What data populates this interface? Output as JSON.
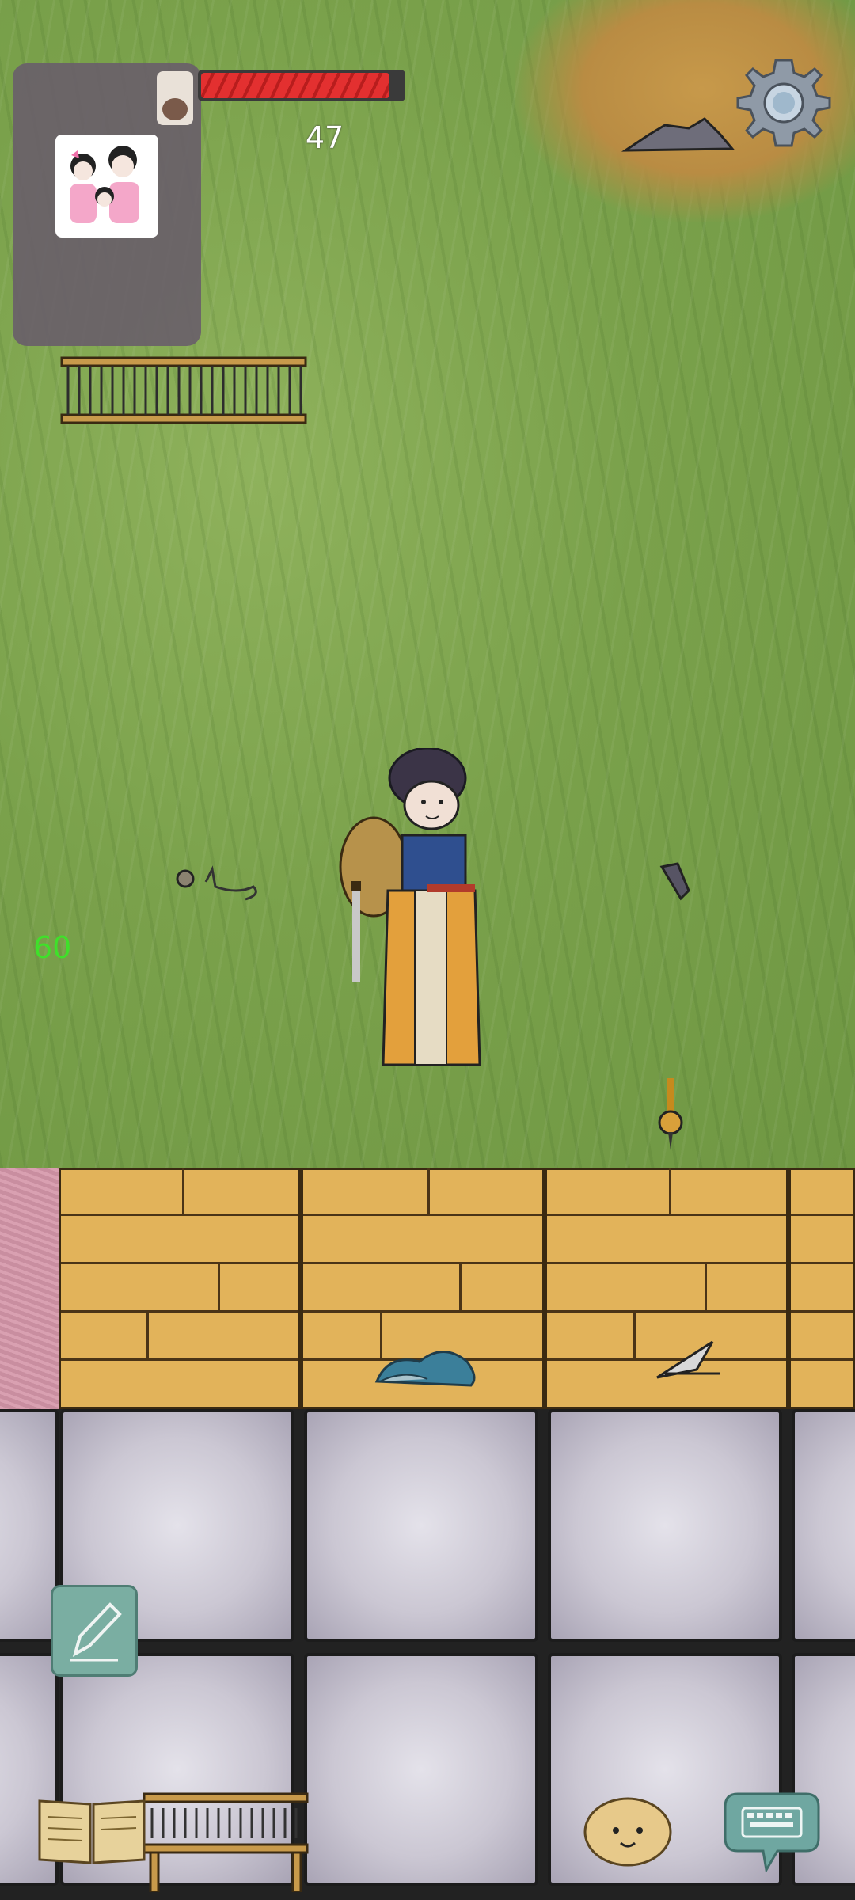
{
  "hud": {
    "food_count": "47",
    "fps": "60",
    "health_fraction": 0.94
  },
  "icons": {
    "settings": "gear-icon",
    "write": "pencil-icon",
    "journal": "book-icon",
    "emote": "face-icon",
    "chat": "keyboard-icon"
  },
  "colors": {
    "grass": "#7fa552",
    "health": "#e33030",
    "fps_text": "#3fe02a",
    "button_teal": "#7aaea2"
  }
}
